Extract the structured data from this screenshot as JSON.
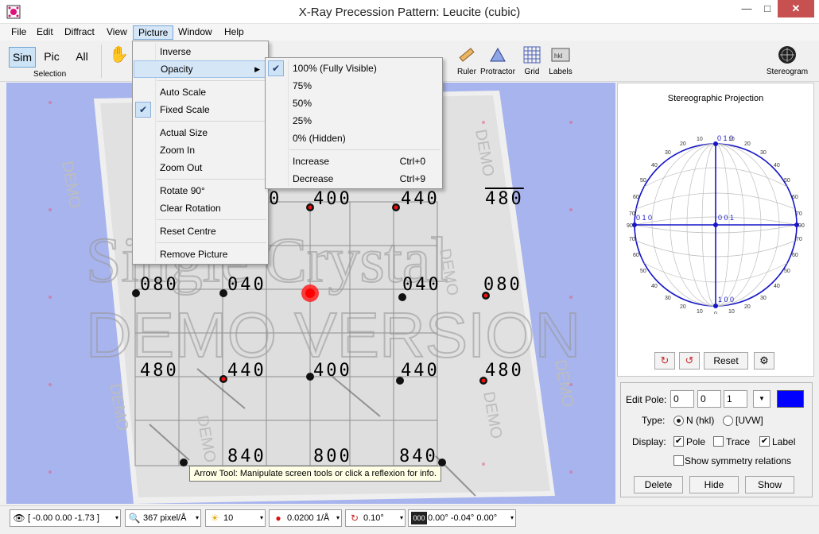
{
  "window": {
    "title": "X-Ray Precession Pattern: Leucite (cubic)",
    "minimize_glyph": "—",
    "maximize_glyph": "□",
    "close_glyph": "✕"
  },
  "menubar": {
    "items": [
      "File",
      "Edit",
      "Diffract",
      "View",
      "Picture",
      "Window",
      "Help"
    ],
    "active": "Picture"
  },
  "toolbar": {
    "modes": [
      "Sim",
      "Pic",
      "All"
    ],
    "selected_mode": "Sim",
    "selection_label": "Selection",
    "tools": [
      {
        "label": "Ruler",
        "icon": "ruler-icon"
      },
      {
        "label": "Protractor",
        "icon": "protractor-icon"
      },
      {
        "label": "Grid",
        "icon": "grid-icon"
      },
      {
        "label": "Labels",
        "icon": "labels-icon"
      },
      {
        "label": "Stereogram",
        "icon": "stereogram-icon"
      }
    ],
    "partial_label": "s"
  },
  "picture_menu": {
    "items": [
      {
        "label": "Inverse"
      },
      {
        "label": "Opacity",
        "submenu": true,
        "highlighted": true
      },
      {
        "label": "Auto Scale"
      },
      {
        "label": "Fixed Scale",
        "checked": true
      },
      {
        "label": "Actual Size"
      },
      {
        "label": "Zoom In"
      },
      {
        "label": "Zoom Out"
      },
      {
        "label": "Rotate 90°"
      },
      {
        "label": "Clear Rotation"
      },
      {
        "label": "Reset Centre"
      },
      {
        "label": "Remove Picture"
      }
    ]
  },
  "opacity_menu": {
    "items": [
      {
        "label": "100% (Fully Visible)",
        "checked": true
      },
      {
        "label": "75%"
      },
      {
        "label": "50%"
      },
      {
        "label": "25%"
      },
      {
        "label": "0% (Hidden)"
      },
      {
        "label": "Increase",
        "shortcut": "Ctrl+0"
      },
      {
        "label": "Decrease",
        "shortcut": "Ctrl+9"
      }
    ]
  },
  "pattern": {
    "watermark_big_1": "Single Crystal",
    "watermark_big_2": "DEMO VERSION",
    "watermark_small": "DEMO",
    "row1": [
      "400",
      "440",
      "480"
    ],
    "row2": [
      "080",
      "040",
      "040",
      "080"
    ],
    "row3": [
      "480",
      "440",
      "400",
      "440",
      "480"
    ],
    "row4": [
      "840",
      "800",
      "840"
    ],
    "partial_0": "0"
  },
  "stereogram": {
    "title": "Stereographic Projection",
    "pole_labels": {
      "top": "0 1 0",
      "left": "0 1 0",
      "center": "0 0 1",
      "bottom": "1 0 0"
    },
    "ticks": [
      "10",
      "20",
      "30",
      "40",
      "50",
      "60",
      "70",
      "80",
      "90",
      "0"
    ],
    "reset_label": "Reset"
  },
  "edit_pole": {
    "label": "Edit Pole:",
    "h": "0",
    "k": "0",
    "l": "1",
    "color": "#0000ff",
    "type_label": "Type:",
    "type_options": [
      "N (hkl)",
      "[UVW]"
    ],
    "type_selected": "N (hkl)",
    "display_label": "Display:",
    "display_options": [
      {
        "label": "Pole",
        "checked": true
      },
      {
        "label": "Trace",
        "checked": false
      },
      {
        "label": "Label",
        "checked": true
      }
    ],
    "symmetry_label": "Show symmetry relations",
    "symmetry_checked": false,
    "buttons": [
      "Delete",
      "Hide",
      "Show"
    ]
  },
  "tooltip": "Arrow Tool: Manipulate screen tools or click a reflexion for info.",
  "statusbar": {
    "view_dir": "[ -0.00 0.00 -1.73 ]",
    "zoom": "367 pixel/Å",
    "brightness": "10",
    "spot_size": "0.0200 1/Å",
    "rotation": "0.10°",
    "orientation": "0.00° -0.04° 0.00°"
  }
}
